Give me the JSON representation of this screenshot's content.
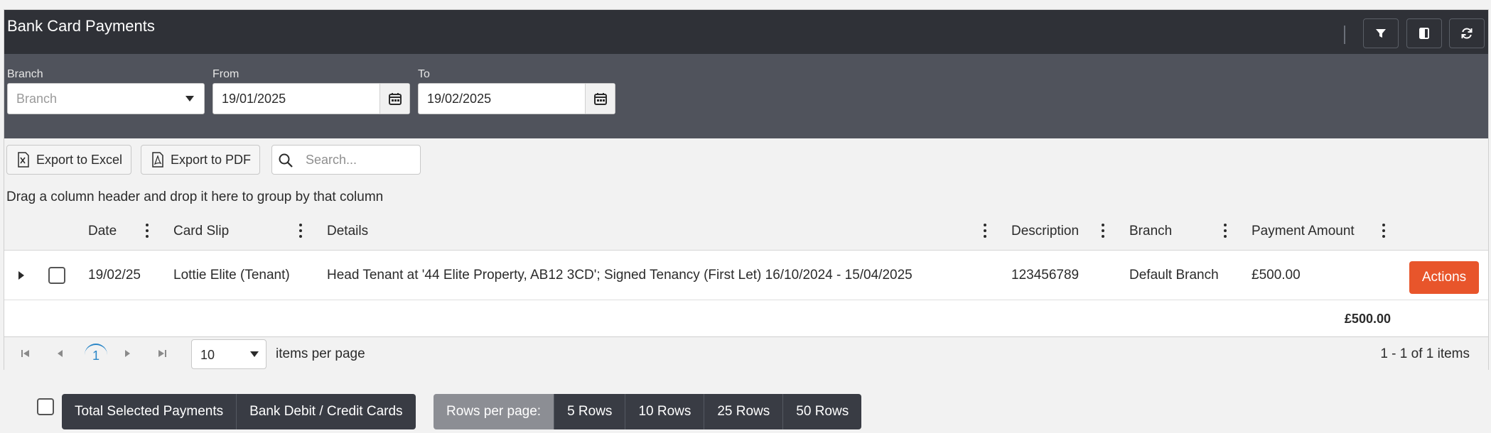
{
  "title": "Bank Card Payments",
  "toolbar_icons": [
    "filter-icon",
    "columns-icon",
    "refresh-icon"
  ],
  "filters": {
    "branch": {
      "label": "Branch",
      "placeholder": "Branch"
    },
    "from": {
      "label": "From",
      "value": "19/01/2025"
    },
    "to": {
      "label": "To",
      "value": "19/02/2025"
    }
  },
  "grid_toolbar": {
    "export_excel": "Export to Excel",
    "export_pdf": "Export to PDF",
    "search_placeholder": "Search..."
  },
  "group_hint": "Drag a column header and drop it here to group by that column",
  "columns": [
    "Date",
    "Card Slip",
    "Details",
    "Description",
    "Branch",
    "Payment Amount"
  ],
  "rows": [
    {
      "date": "19/02/25",
      "card_slip": "Lottie Elite (Tenant)",
      "details": "Head Tenant at '44 Elite Property, AB12 3CD'; Signed Tenancy (First Let) 16/10/2024 - 15/04/2025",
      "description": "123456789",
      "branch": "Default Branch",
      "amount": "£500.00",
      "action": "Actions"
    }
  ],
  "total": "£500.00",
  "pager": {
    "current_page": "1",
    "page_size": "10",
    "page_size_label": "items per page",
    "info": "1 - 1 of 1 items"
  },
  "bottom": {
    "total_selected": "Total Selected Payments",
    "bank_cards": "Bank Debit / Credit Cards",
    "rows_per_page": "Rows per page:",
    "rows_options": [
      "5 Rows",
      "10 Rows",
      "25 Rows",
      "50 Rows"
    ]
  },
  "colors": {
    "header": "#2f3137",
    "filter_bar": "#50535c",
    "action": "#e8552b",
    "page_link": "#2a86c7"
  }
}
